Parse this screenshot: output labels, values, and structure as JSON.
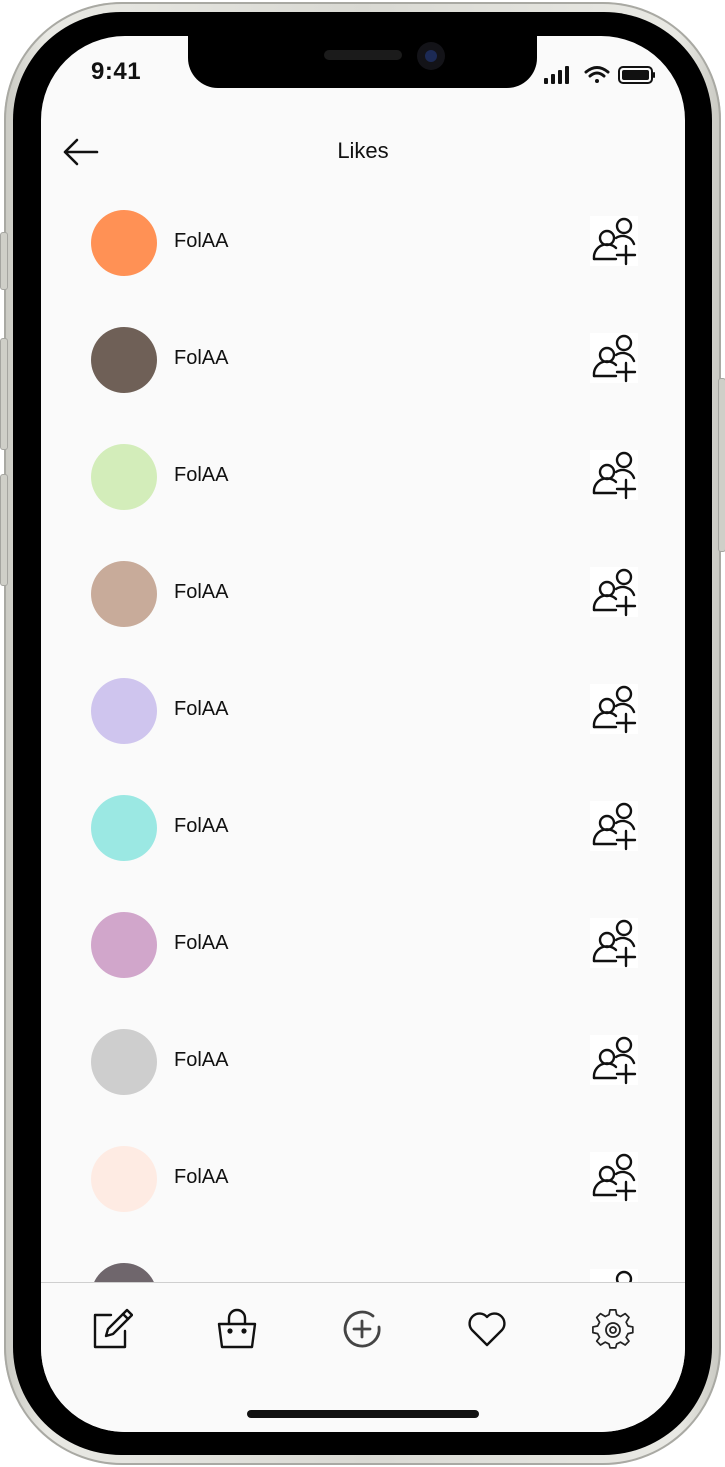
{
  "status_bar": {
    "time": "9:41"
  },
  "header": {
    "title": "Likes"
  },
  "likes": [
    {
      "name": "FolAA",
      "avatar_color": "#FF9155"
    },
    {
      "name": "FolAA",
      "avatar_color": "#6F6057"
    },
    {
      "name": "FolAA",
      "avatar_color": "#D3EDBA"
    },
    {
      "name": "FolAA",
      "avatar_color": "#C8AB9A"
    },
    {
      "name": "FolAA",
      "avatar_color": "#CFC5EE"
    },
    {
      "name": "FolAA",
      "avatar_color": "#9BE8E3"
    },
    {
      "name": "FolAA",
      "avatar_color": "#D1A6CB"
    },
    {
      "name": "FolAA",
      "avatar_color": "#CECECE"
    },
    {
      "name": "FolAA",
      "avatar_color": "#FEEBE3"
    },
    {
      "name": "",
      "avatar_color": "#6F666C"
    }
  ],
  "tab_bar": [
    {
      "icon": "edit-icon"
    },
    {
      "icon": "shopping-basket-icon"
    },
    {
      "icon": "add-circle-icon"
    },
    {
      "icon": "heart-icon"
    },
    {
      "icon": "settings-gear-icon"
    }
  ]
}
